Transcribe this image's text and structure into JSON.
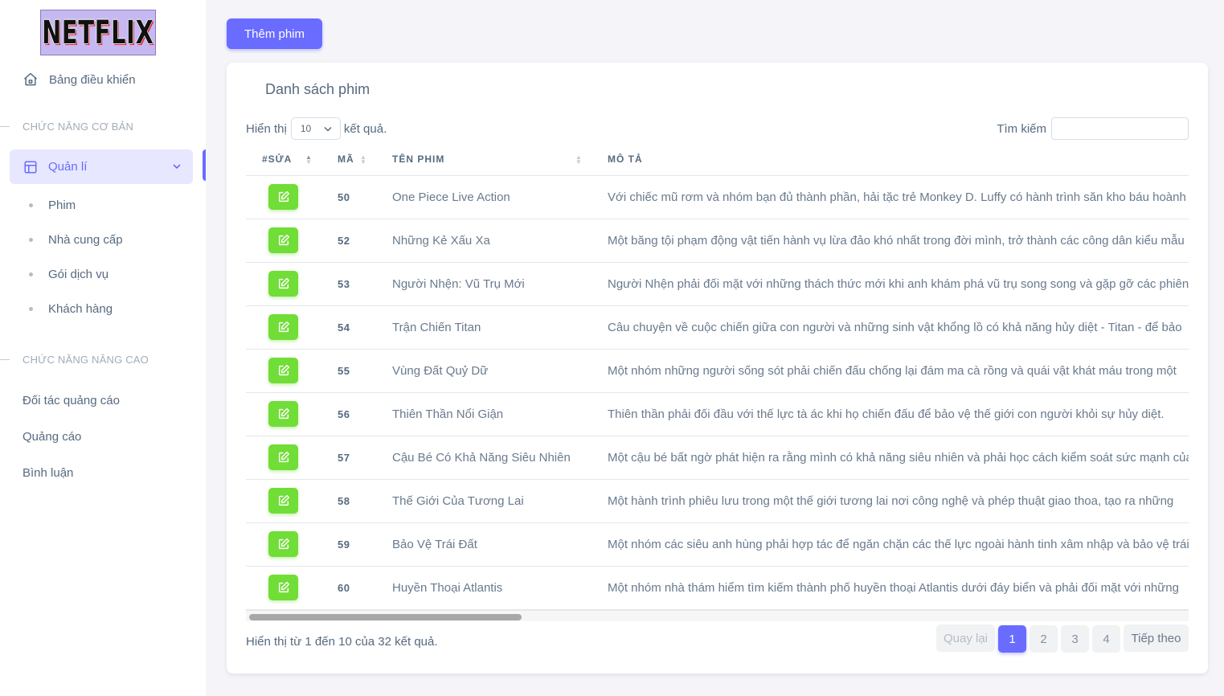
{
  "sidebar": {
    "logo_text": "NETFLIX",
    "dashboard": "Bảng điều khiển",
    "section_basic": "CHỨC NĂNG CƠ BẢN",
    "manage": "Quản lí",
    "sub_items": [
      "Phim",
      "Nhà cung cấp",
      "Gói dịch vụ",
      "Khách hàng"
    ],
    "section_advanced": "CHỨC NĂNG NÂNG CAO",
    "advanced_items": [
      "Đối tác quảng cáo",
      "Quảng cáo",
      "Bình luận"
    ]
  },
  "toolbar": {
    "add_label": "Thêm phim"
  },
  "card": {
    "title": "Danh sách phim",
    "length_prefix": "Hiển thị",
    "length_value": "10",
    "length_suffix": "kết quả.",
    "search_label": "Tìm kiếm",
    "search_value": ""
  },
  "table": {
    "columns": [
      "#SỬA",
      "MÃ",
      "TÊN PHIM",
      "MÔ TẢ"
    ],
    "rows": [
      {
        "code": "50",
        "name": "One Piece Live Action",
        "desc": "Với chiếc mũ rơm và nhóm bạn đủ thành phần, hải tặc trẻ Monkey D. Luffy có hành trình săn kho báu hoành"
      },
      {
        "code": "52",
        "name": "Những Kẻ Xấu Xa",
        "desc": "Một băng tội phạm động vật tiến hành vụ lừa đảo khó nhất trong đời mình, trở thành các công dân kiểu mẫu"
      },
      {
        "code": "53",
        "name": "Người Nhện: Vũ Trụ Mới",
        "desc": "Người Nhện phải đối mặt với những thách thức mới khi anh khám phá vũ trụ song song và gặp gỡ các phiên"
      },
      {
        "code": "54",
        "name": "Trận Chiến Titan",
        "desc": "Câu chuyện về cuộc chiến giữa con người và những sinh vật khổng lồ có khả năng hủy diệt - Titan - để bảo"
      },
      {
        "code": "55",
        "name": "Vùng Đất Quỷ Dữ",
        "desc": "Một nhóm những người sống sót phải chiến đấu chống lại đám ma cà rồng và quái vật khát máu trong một"
      },
      {
        "code": "56",
        "name": "Thiên Thần Nổi Giận",
        "desc": "Thiên thần phải đối đầu với thế lực tà ác khi họ chiến đấu để bảo vệ thế giới con người khỏi sự hủy diệt."
      },
      {
        "code": "57",
        "name": "Cậu Bé Có Khả Năng Siêu Nhiên",
        "desc": "Một cậu bé bất ngờ phát hiện ra rằng mình có khả năng siêu nhiên và phải học cách kiểm soát sức mạnh của"
      },
      {
        "code": "58",
        "name": "Thế Giới Của Tương Lai",
        "desc": "Một hành trình phiêu lưu trong một thế giới tương lai nơi công nghệ và phép thuật giao thoa, tạo ra những"
      },
      {
        "code": "59",
        "name": "Bảo Vệ Trái Đất",
        "desc": "Một nhóm các siêu anh hùng phải hợp tác để ngăn chặn các thế lực ngoài hành tinh xâm nhập và bảo vệ trái"
      },
      {
        "code": "60",
        "name": "Huyền Thoại Atlantis",
        "desc": "Một nhóm nhà thám hiểm tìm kiếm thành phố huyền thoại Atlantis dưới đáy biển và phải đối mặt với những"
      }
    ]
  },
  "footer": {
    "info": "Hiển thị từ 1 đến 10 của 32 kết quả.",
    "prev": "Quay lại",
    "pages": [
      "1",
      "2",
      "3",
      "4"
    ],
    "next": "Tiếp theo"
  },
  "colors": {
    "accent": "#696cff",
    "edit": "#71dd37"
  }
}
